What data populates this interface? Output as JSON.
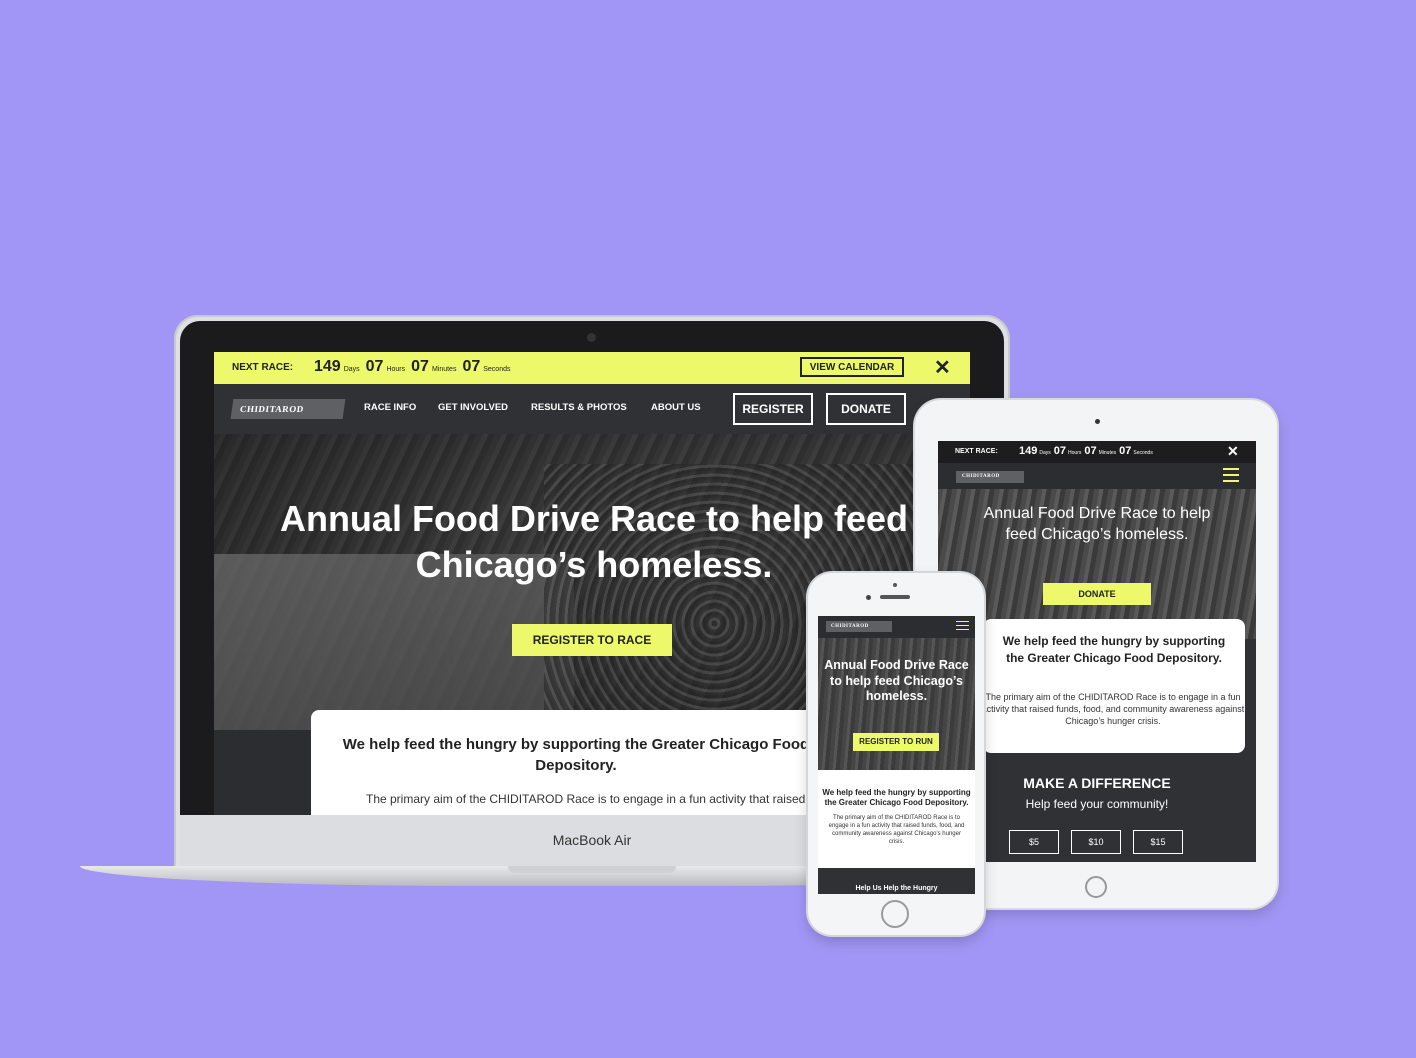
{
  "countdown": {
    "label": "NEXT RACE:",
    "days": "149",
    "days_unit": "Days",
    "hours": "07",
    "hours_unit": "Hours",
    "minutes": "07",
    "minutes_unit": "Minutes",
    "seconds": "07",
    "seconds_unit": "Seconds",
    "close": "✕"
  },
  "desktop": {
    "view_calendar": "VIEW CALENDAR",
    "logo": "CHIDITAROD",
    "nav": [
      "RACE INFO",
      "GET INVOLVED",
      "RESULTS & PHOTOS",
      "ABOUT US"
    ],
    "register": "REGISTER",
    "donate": "DONATE",
    "hero_title": "Annual Food Drive Race to help feed Chicago’s homeless.",
    "hero_cta": "REGISTER TO RACE",
    "card_title": "We help feed the hungry by supporting the Greater Chicago Food Depository.",
    "card_text": "The primary aim of the CHIDITAROD Race is to engage in a fun activity that raised funds, food, and community awareness"
  },
  "laptop_label": "MacBook Air",
  "tablet": {
    "logo": "CHIDITAROD",
    "hero_title": "Annual Food Drive Race to help feed Chicago’s homeless.",
    "hero_cta": "DONATE",
    "card_title": "We help feed the hungry by supporting the Greater Chicago Food Depository.",
    "card_text": "The primary aim of the CHIDITAROD Race is to engage in a fun activity that raised funds, food, and community awareness against Chicago’s hunger crisis.",
    "make_difference": "MAKE A DIFFERENCE",
    "help_text": "Help feed your community!",
    "amounts": [
      "$5",
      "$10",
      "$15"
    ]
  },
  "phone": {
    "logo": "CHIDITAROD",
    "hero_title": "Annual Food Drive Race to help feed Chicago’s homeless.",
    "hero_cta": "REGISTER TO RUN",
    "card_title": "We help feed the hungry by supporting the Greater Chicago Food Depository.",
    "card_text": "The primary aim of the CHIDITAROD Race is to engage in a fun activity that raised funds, food, and community awareness against Chicago’s hunger crisis.",
    "footer_heading": "Help Us Help the Hungry"
  },
  "colors": {
    "background": "#a196f5",
    "accent": "#edf86b",
    "dark": "#2f3134"
  },
  "icons": [
    "close-icon",
    "hamburger-menu-icon",
    "logo-icon",
    "camera-icon",
    "home-button-icon"
  ]
}
